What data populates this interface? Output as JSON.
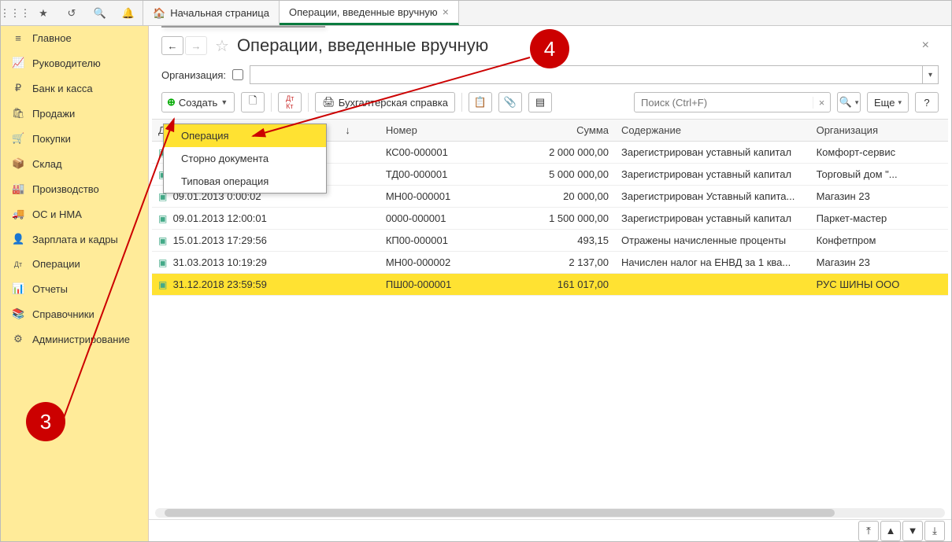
{
  "topIcons": [
    "apps-icon",
    "star-icon",
    "history-icon",
    "search-icon",
    "bell-icon"
  ],
  "tabs": [
    {
      "label": "Начальная страница",
      "icon": "home-icon",
      "active": false,
      "closable": false
    },
    {
      "label": "Операции, введенные вручную",
      "icon": "",
      "active": true,
      "closable": true
    }
  ],
  "sidebar": [
    {
      "icon": "≡",
      "label": "Главное"
    },
    {
      "icon": "📈",
      "label": "Руководителю"
    },
    {
      "icon": "₽",
      "label": "Банк и касса"
    },
    {
      "icon": "🛍",
      "label": "Продажи"
    },
    {
      "icon": "🛒",
      "label": "Покупки"
    },
    {
      "icon": "📦",
      "label": "Склад"
    },
    {
      "icon": "🏭",
      "label": "Производство"
    },
    {
      "icon": "🚚",
      "label": "ОС и НМА"
    },
    {
      "icon": "👤",
      "label": "Зарплата и кадры"
    },
    {
      "icon": "Дт",
      "label": "Операции"
    },
    {
      "icon": "📊",
      "label": "Отчеты"
    },
    {
      "icon": "📚",
      "label": "Справочники"
    },
    {
      "icon": "⚙",
      "label": "Администрирование"
    }
  ],
  "page_title": "Операции, введенные вручную",
  "org": {
    "label": "Организация:",
    "value": ""
  },
  "toolbar": {
    "create": "Создать",
    "refresh_icon": "refresh-icon",
    "dtkt": "ДтКт",
    "print": "print-icon",
    "ref": "Бухгалтерская справка",
    "copy_icon": "copy-icon",
    "attach_icon": "attach-icon",
    "list_icon": "list-icon",
    "search_placeholder": "Поиск (Ctrl+F)",
    "search_icon": "search-icon",
    "more": "Еще",
    "help": "?"
  },
  "create_menu": [
    "Операция",
    "Сторно документа",
    "Типовая операция"
  ],
  "columns": {
    "date": "Дата",
    "sort": "↓",
    "number": "Номер",
    "sum": "Сумма",
    "desc": "Содержание",
    "org": "Организация"
  },
  "rows": [
    {
      "date": "",
      "number": "КС00-000001",
      "sum": "2 000 000,00",
      "desc": "Зарегистрирован уставный капитал",
      "org": "Комфорт-сервис"
    },
    {
      "date": "",
      "number": "ТД00-000001",
      "sum": "5 000 000,00",
      "desc": "Зарегистрирован уставный капитал",
      "org": "Торговый дом \"..."
    },
    {
      "date": "09.01.2013 0:00:02",
      "number": "МН00-000001",
      "sum": "20 000,00",
      "desc": "Зарегистрирован Уставный капита...",
      "org": "Магазин 23"
    },
    {
      "date": "09.01.2013 12:00:01",
      "number": "0000-000001",
      "sum": "1 500 000,00",
      "desc": "Зарегистрирован уставный капитал",
      "org": "Паркет-мастер"
    },
    {
      "date": "15.01.2013 17:29:56",
      "number": "КП00-000001",
      "sum": "493,15",
      "desc": "Отражены начисленные проценты",
      "org": "Конфетпром"
    },
    {
      "date": "31.03.2013 10:19:29",
      "number": "МН00-000002",
      "sum": "2 137,00",
      "desc": "Начислен налог на ЕНВД за 1 ква...",
      "org": "Магазин 23"
    },
    {
      "date": "31.12.2018 23:59:59",
      "number": "ПШ00-000001",
      "sum": "161 017,00",
      "desc": "",
      "org": "РУС ШИНЫ ООО",
      "selected": true
    }
  ],
  "callouts": {
    "c3": "3",
    "c4": "4"
  }
}
